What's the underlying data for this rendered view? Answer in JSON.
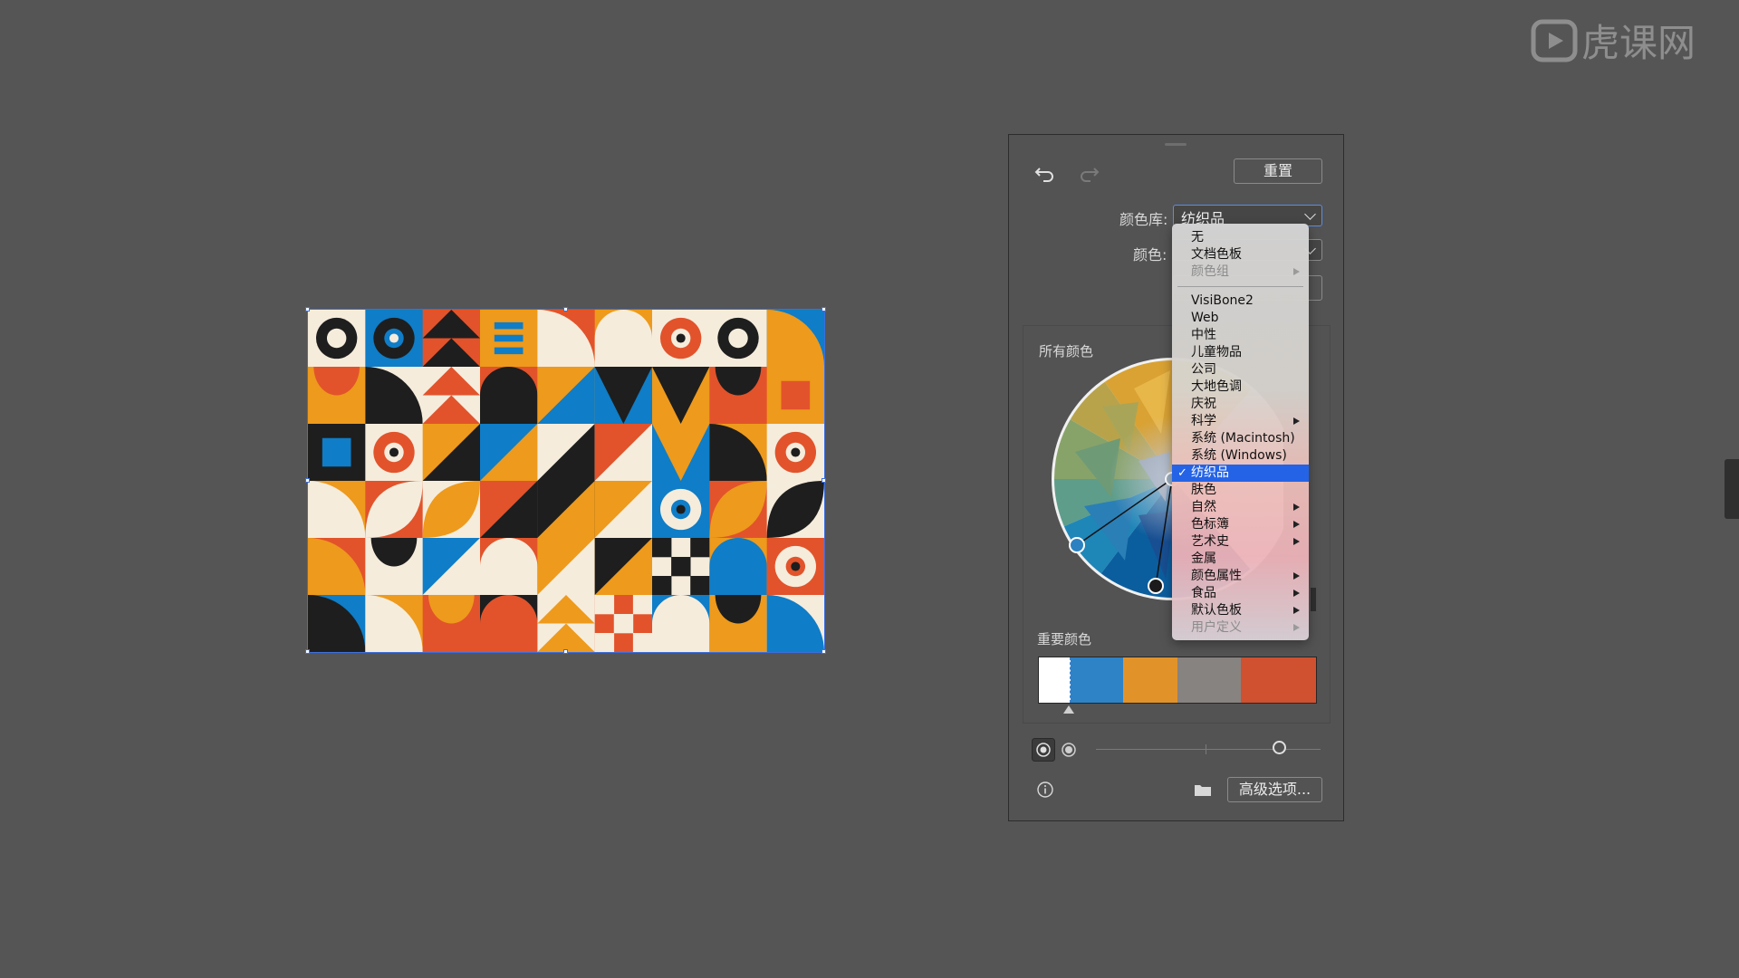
{
  "watermark": {
    "text": "虎课网"
  },
  "panel": {
    "reset_label": "重置",
    "library_label": "颜色库:",
    "library_value": "纺织品",
    "colors_label": "颜色:",
    "all_colors_label": "所有颜色",
    "important_colors_label": "重要颜色",
    "advanced_label": "高级选项...",
    "swatches": [
      "#ffffff",
      "#2e83c6",
      "#e1932a",
      "#878381",
      "#cf512f"
    ]
  },
  "icons": {
    "undo": "undo-arrow-icon",
    "redo": "redo-arrow-icon",
    "info": "info-icon",
    "folder": "folder-icon",
    "radio_on": "radio-selected-icon",
    "radio_off": "radio-unselected-icon"
  },
  "library_menu": [
    {
      "label": "无",
      "state": "normal",
      "submenu": false
    },
    {
      "label": "文档色板",
      "state": "normal",
      "submenu": false
    },
    {
      "label": "颜色组",
      "state": "disabled",
      "submenu": true
    },
    {
      "label": "VisiBone2",
      "state": "normal",
      "submenu": false
    },
    {
      "label": "Web",
      "state": "normal",
      "submenu": false
    },
    {
      "label": "中性",
      "state": "normal",
      "submenu": false
    },
    {
      "label": "儿童物品",
      "state": "normal",
      "submenu": false
    },
    {
      "label": "公司",
      "state": "normal",
      "submenu": false
    },
    {
      "label": "大地色调",
      "state": "normal",
      "submenu": false
    },
    {
      "label": "庆祝",
      "state": "normal",
      "submenu": false
    },
    {
      "label": "科学",
      "state": "normal",
      "submenu": true
    },
    {
      "label": "系统 (Macintosh)",
      "state": "normal",
      "submenu": false
    },
    {
      "label": "系统 (Windows)",
      "state": "normal",
      "submenu": false
    },
    {
      "label": "纺织品",
      "state": "selected",
      "submenu": false
    },
    {
      "label": "肤色",
      "state": "normal",
      "submenu": false
    },
    {
      "label": "自然",
      "state": "normal",
      "submenu": true
    },
    {
      "label": "色标簿",
      "state": "normal",
      "submenu": true
    },
    {
      "label": "艺术史",
      "state": "normal",
      "submenu": true
    },
    {
      "label": "金属",
      "state": "normal",
      "submenu": false
    },
    {
      "label": "颜色属性",
      "state": "normal",
      "submenu": true
    },
    {
      "label": "食品",
      "state": "normal",
      "submenu": true
    },
    {
      "label": "默认色板",
      "state": "normal",
      "submenu": true
    },
    {
      "label": "用户定义",
      "state": "disabled",
      "submenu": true
    }
  ],
  "artwork_palette": {
    "cream": "#f5ecdc",
    "orange": "#ee9a1c",
    "red": "#e2532b",
    "blue": "#0f7dc7",
    "black": "#1e1e1e"
  }
}
